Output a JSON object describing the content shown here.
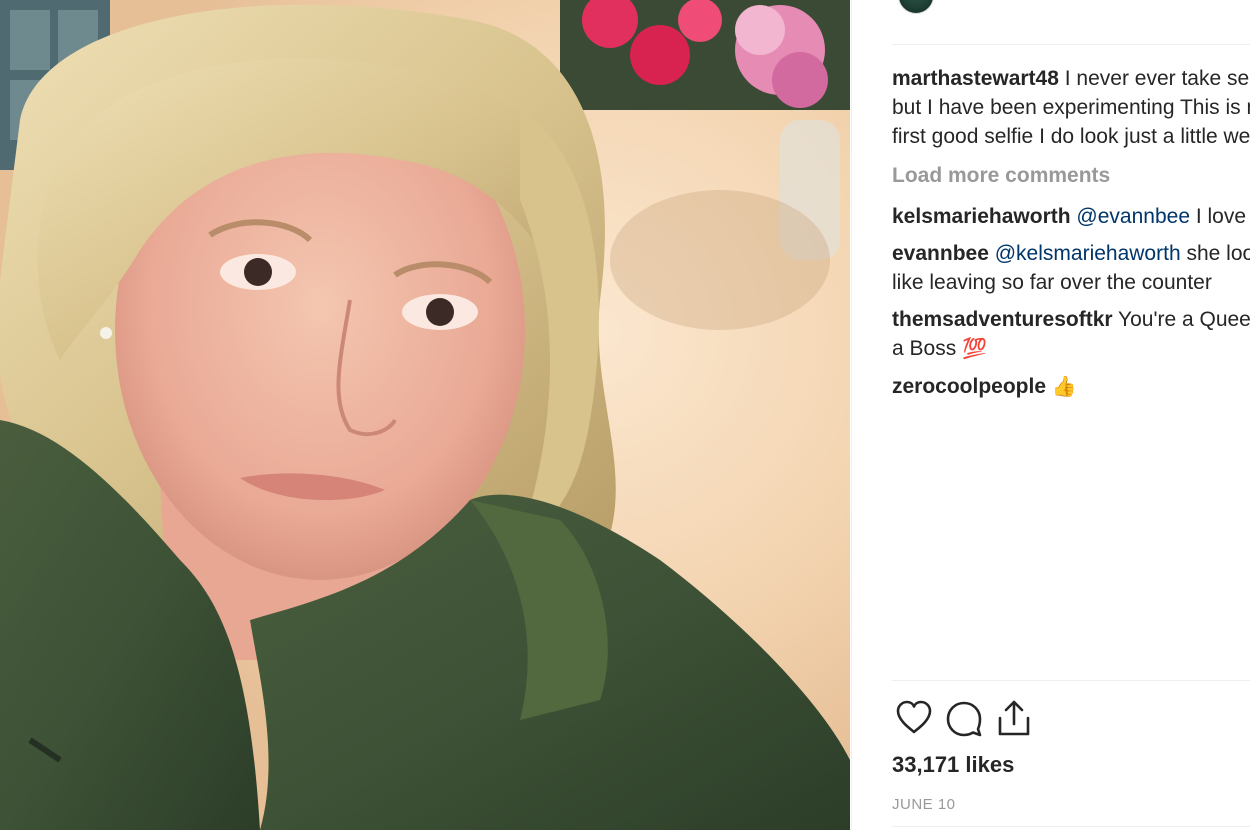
{
  "post": {
    "likes": "33,171 likes",
    "date": "JUNE 10"
  },
  "caption": {
    "user": "marthastewart48",
    "text": " I never ever take selfies but I have been experimenting This is my first good selfie I do look just a little weird !"
  },
  "load_more": "Load more comments",
  "comments": [
    {
      "user": "kelsmariehaworth",
      "mention": "@evannbee",
      "text": " I love this"
    },
    {
      "user": "evannbee",
      "mention": "@kelsmariehaworth",
      "text": " she looks like leaving so far over the counter"
    },
    {
      "user": "themsadventuresoftkr",
      "text": " You're a Queen and a Boss",
      "emoji": "💯"
    },
    {
      "user": "zerocoolpeople",
      "text": " ",
      "emoji": "👍"
    }
  ],
  "icons": {
    "like": "heart-icon",
    "comment": "comment-bubble-icon",
    "share": "share-upload-icon"
  },
  "colors": {
    "username": "#262626",
    "mention": "#003569",
    "muted": "#999999",
    "divider": "#efefef"
  }
}
